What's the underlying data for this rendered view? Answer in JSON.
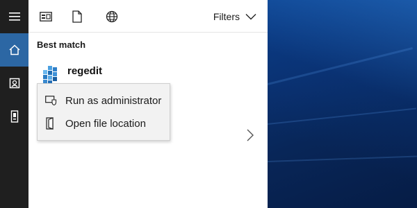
{
  "toolbar": {
    "filters_label": "Filters",
    "icons": [
      "apps-icon",
      "document-icon",
      "web-globe-icon",
      "chevron-down-icon"
    ]
  },
  "rail": {
    "icons": [
      "hamburger-menu-icon",
      "home-icon",
      "notebook-icon",
      "device-icon"
    ],
    "active_index": 1
  },
  "results": {
    "section_label": "Best match",
    "best_match": {
      "title": "regedit",
      "icon": "registry-editor-icon"
    }
  },
  "context_menu": {
    "items": [
      {
        "label": "Run as administrator",
        "icon": "shield-icon"
      },
      {
        "label": "Open file location",
        "icon": "folder-open-icon"
      }
    ]
  },
  "colors": {
    "rail": "#1f1f1f",
    "rail_active": "#2c67a4",
    "panel": "#ffffff",
    "menu": "#f2f2f2",
    "desktop": "#0a2f6c"
  }
}
